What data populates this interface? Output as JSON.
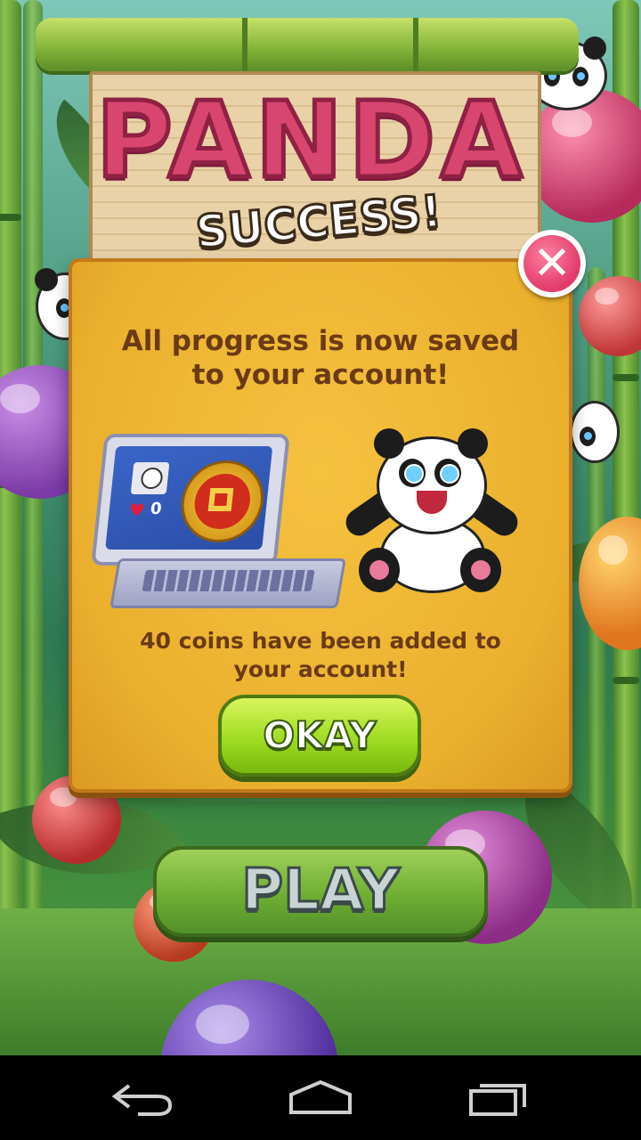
{
  "game": {
    "title": "PANDA",
    "banner": "SUCCESS!"
  },
  "dialog": {
    "message": "All progress is now saved to your account!",
    "coins_message": "40 coins have been added to your account!",
    "okay_label": "OKAY",
    "laptop_screen": {
      "lives": "0"
    }
  },
  "main": {
    "play_label": "PLAY"
  },
  "system_nav": {
    "items": [
      "back-icon",
      "home-icon",
      "recent-apps-icon"
    ]
  }
}
